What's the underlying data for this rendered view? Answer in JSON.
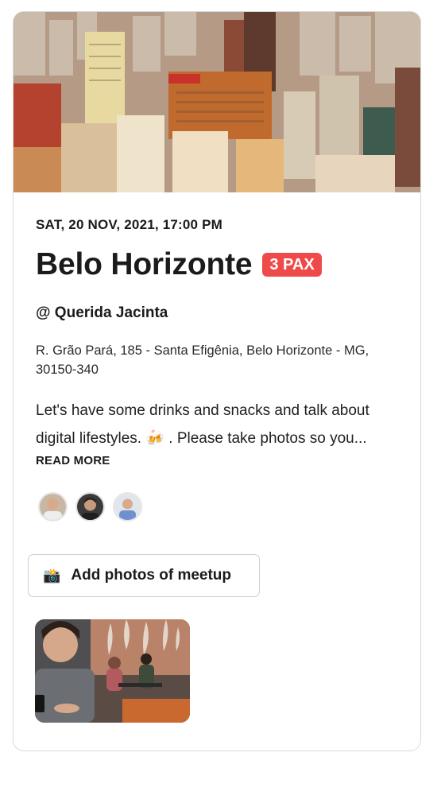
{
  "event": {
    "datetime": "SAT, 20 NOV, 2021, 17:00 PM",
    "city": "Belo Horizonte",
    "pax": "3 PAX",
    "venue": "@ Querida Jacinta",
    "address": "R. Grão Pará, 185 - Santa Efigênia, Belo Horizonte - MG, 30150-340",
    "description": "Let's have some drinks and snacks and talk about digital lifestyles. 🍻 . Please take photos so you...",
    "read_more": "READ MORE"
  },
  "attendees": [
    {
      "name": "attendee-1"
    },
    {
      "name": "attendee-2"
    },
    {
      "name": "attendee-3"
    }
  ],
  "actions": {
    "add_photos_icon": "📸",
    "add_photos_label": "Add photos of meetup"
  },
  "colors": {
    "pax_badge": "#ef4a4a",
    "text": "#1b1b1b",
    "border": "#d9d9d9"
  },
  "icons": {
    "camera": "camera-flash-icon"
  }
}
